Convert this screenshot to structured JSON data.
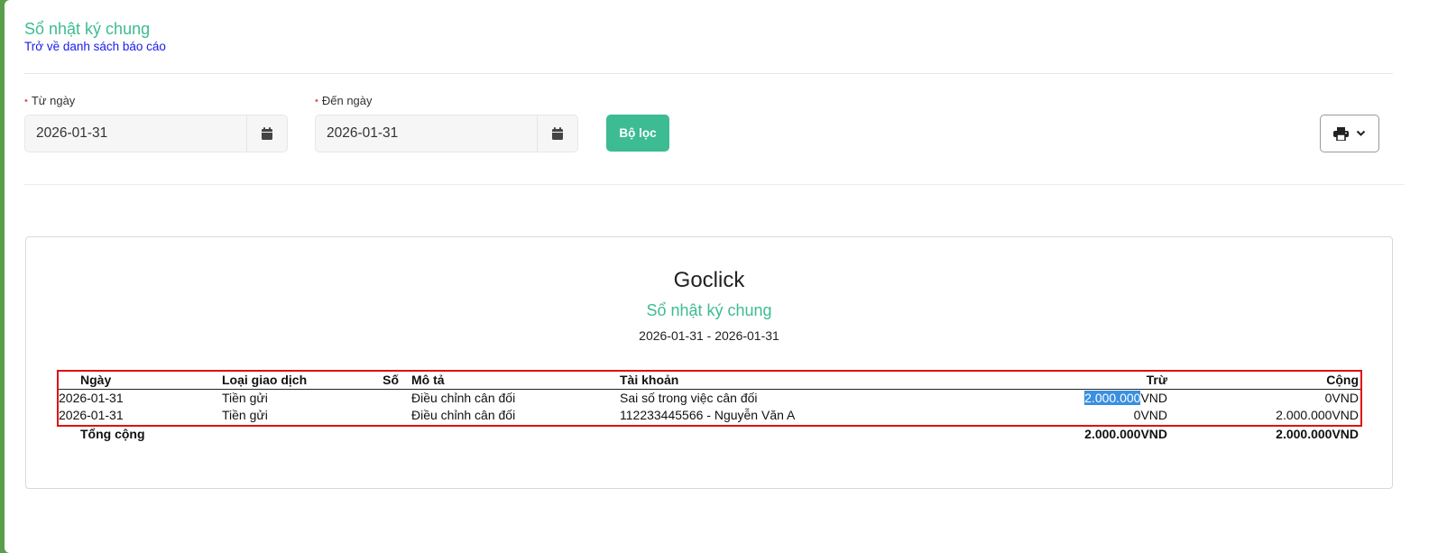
{
  "header": {
    "title": "Sổ nhật ký chung",
    "back_link": "Trở về danh sách báo cáo"
  },
  "filters": {
    "from_label": "Từ ngày",
    "from_value": "2026-01-31",
    "to_label": "Đến ngày",
    "to_value": "2026-01-31",
    "required_mark": "•",
    "filter_button": "Bộ lọc",
    "icons": {
      "calendar": "calendar-icon",
      "print": "print-icon",
      "dropdown": "chevron-down-icon"
    }
  },
  "report": {
    "company": "Goclick",
    "title": "Sổ nhật ký chung",
    "date_range": "2026-01-31 - 2026-01-31",
    "columns": {
      "date": "Ngày",
      "type": "Loại giao dịch",
      "number": "Số",
      "description": "Mô tả",
      "account": "Tài khoản",
      "debit": "Trừ",
      "credit": "Cộng"
    },
    "rows": [
      {
        "date": "2026-01-31",
        "type": "Tiền gửi",
        "number": "",
        "description": "Điều chỉnh cân đối",
        "account": "Sai số trong việc cân đối",
        "debit_amount": "2.000.000",
        "debit_unit": "VND",
        "credit": "0VND"
      },
      {
        "date": "2026-01-31",
        "type": "Tiền gửi",
        "number": "",
        "description": "Điều chỉnh cân đối",
        "account": "112233445566 - Nguyễn Văn A",
        "debit_amount": "0",
        "debit_unit": "VND",
        "credit": "2.000.000VND"
      }
    ],
    "total": {
      "label": "Tổng cộng",
      "debit": "2.000.000VND",
      "credit": "2.000.000VND"
    }
  },
  "colors": {
    "accent": "#3dbb93",
    "link": "#1a1aee",
    "highlight_border": "#e01010",
    "selection": "#3a8fe0",
    "window_frame": "#5a9e4a"
  }
}
